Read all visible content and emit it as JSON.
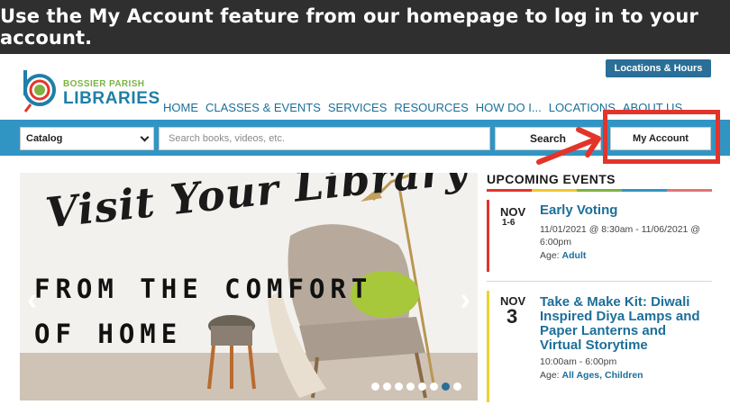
{
  "banner": {
    "text": "Use the My Account feature from our homepage to log in to your account."
  },
  "header": {
    "logo_top": "BOSSIER PARISH",
    "logo_bottom": "LIBRARIES",
    "locations_button": "Locations & Hours"
  },
  "nav": {
    "items": [
      {
        "label": "HOME"
      },
      {
        "label": "CLASSES & EVENTS"
      },
      {
        "label": "SERVICES"
      },
      {
        "label": "RESOURCES"
      },
      {
        "label": "HOW DO I..."
      },
      {
        "label": "LOCATIONS"
      },
      {
        "label": "ABOUT US"
      }
    ]
  },
  "search": {
    "catalog_value": "Catalog",
    "placeholder": "Search books, videos, etc.",
    "search_button": "Search",
    "account_button": "My Account"
  },
  "hero": {
    "line1": "Visit Your Library",
    "line2": "FROM THE COMFORT",
    "line3": "OF HOME",
    "prev_icon": "‹",
    "next_icon": "›",
    "dot_count": 8,
    "active_dot": 6
  },
  "events": {
    "heading": "UPCOMING EVENTS",
    "stripe_colors": [
      "#e3342b",
      "#f2c52e",
      "#7cb342",
      "#3195c4",
      "#e57373"
    ],
    "items": [
      {
        "month": "NOV",
        "day": "1-6",
        "title": "Early Voting",
        "time": "11/01/2021 @ 8:30am - 11/06/2021 @ 6:00pm",
        "age_label": "Age:",
        "age_value": "Adult",
        "color": "#e3342b"
      },
      {
        "month": "NOV",
        "day": "3",
        "title": "Take & Make Kit: Diwali Inspired Diya Lamps and Paper Lanterns and Virtual Storytime",
        "time": "10:00am - 6:00pm",
        "age_label": "Age:",
        "age_value": "All Ages, Children",
        "color": "#e8d42a"
      }
    ]
  },
  "colors": {
    "banner_bg": "#2f2f2f",
    "brand_blue": "#1c6f99",
    "search_bar": "#3195c4",
    "highlight": "#e3342b"
  }
}
